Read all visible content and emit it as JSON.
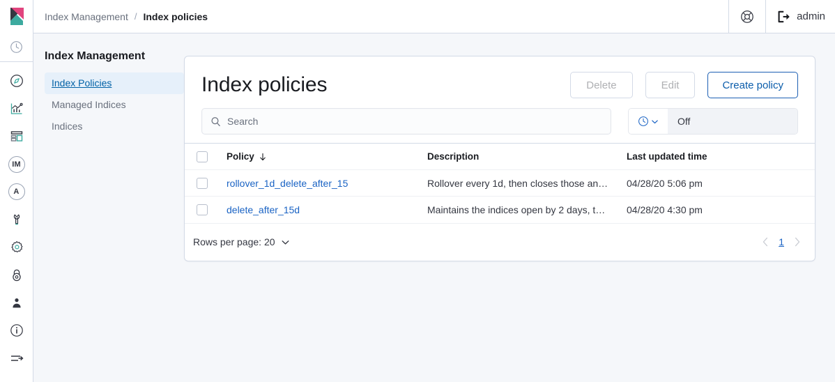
{
  "header": {
    "logo_icon": "kibana-logo",
    "breadcrumbs": [
      {
        "label": "Index Management",
        "current": false
      },
      {
        "label": "Index policies",
        "current": true
      }
    ],
    "separator": "/",
    "help_icon": "lifebuoy-help-icon",
    "user_icon": "sign-out-icon",
    "user_name": "admin"
  },
  "rail": {
    "items": [
      {
        "name": "recently-viewed",
        "icon": "clock-icon",
        "type": "icon"
      },
      {
        "name": "discover",
        "icon": "compass-icon",
        "type": "icon"
      },
      {
        "name": "visualize",
        "icon": "chart-icon",
        "type": "icon"
      },
      {
        "name": "dashboard",
        "icon": "dashboard-icon",
        "type": "icon"
      },
      {
        "name": "index-management",
        "icon": "badge",
        "type": "badge",
        "label": "IM"
      },
      {
        "name": "alerting",
        "icon": "badge",
        "type": "badge",
        "label": "A"
      },
      {
        "name": "dev-tools",
        "icon": "wrench-icon",
        "type": "icon"
      },
      {
        "name": "stack-management",
        "icon": "gear-icon",
        "type": "icon"
      },
      {
        "name": "security",
        "icon": "lock-icon",
        "type": "icon"
      },
      {
        "name": "user",
        "icon": "user-icon",
        "type": "icon"
      },
      {
        "name": "about",
        "icon": "info-icon",
        "type": "icon"
      }
    ],
    "collapse_icon": "collapse-nav-icon"
  },
  "sidebar": {
    "title": "Index Management",
    "items": [
      {
        "label": "Index Policies",
        "active": true
      },
      {
        "label": "Managed Indices",
        "active": false
      },
      {
        "label": "Indices",
        "active": false
      }
    ]
  },
  "panel": {
    "title": "Index policies",
    "buttons": {
      "delete": "Delete",
      "edit": "Edit",
      "create": "Create policy"
    },
    "search": {
      "placeholder": "Search",
      "value": "",
      "icon": "search-icon"
    },
    "refresh": {
      "icon": "clock-icon",
      "chevron": "chevron-down-icon",
      "value": "Off"
    },
    "table": {
      "columns": [
        "Policy",
        "Description",
        "Last updated time"
      ],
      "sorted_column": "Policy",
      "sort_direction": "desc",
      "sort_icon": "arrow-down-icon",
      "rows": [
        {
          "policy": "rollover_1d_delete_after_15",
          "description": "Rollover every 1d, then closes those an…",
          "last_updated": "04/28/20 5:06 pm",
          "checked": false
        },
        {
          "policy": "delete_after_15d",
          "description": "Maintains the indices open by 2 days, t…",
          "last_updated": "04/28/20 4:30 pm",
          "checked": false
        }
      ]
    },
    "footer": {
      "rows_per_page_label": "Rows per page: 20",
      "rows_per_page_icon": "chevron-down-icon",
      "prev_icon": "chevron-left-icon",
      "next_icon": "chevron-right-icon",
      "current_page": "1"
    }
  },
  "colors": {
    "link": "#1a63c4",
    "primary": "#0b5dab",
    "active_bg": "#e6f0fa",
    "page_bg": "#f5f7fa",
    "border": "#d3dae6",
    "logo_pink": "#e1447e",
    "logo_teal": "#3caa9f",
    "logo_dark": "#343741"
  }
}
